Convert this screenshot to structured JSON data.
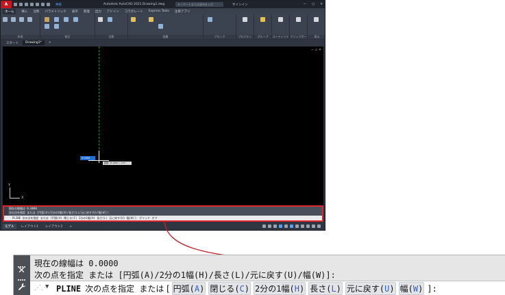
{
  "app": {
    "logo": "A",
    "share_label": "共有",
    "title": "Autodesk AutoCAD 2021   Drawing1.dwg",
    "search_placeholder": "キーワードまたは語句を入力",
    "signin": "サインイン",
    "window_controls": [
      "—",
      "□",
      "✕"
    ]
  },
  "ribbon_tabs": [
    {
      "label": "ホーム",
      "active": true
    },
    {
      "label": "挿入"
    },
    {
      "label": "注釈"
    },
    {
      "label": "パラメトリック"
    },
    {
      "label": "表示"
    },
    {
      "label": "管理"
    },
    {
      "label": "出力"
    },
    {
      "label": "アドイン"
    },
    {
      "label": "コラボレート"
    },
    {
      "label": "Express Tools"
    },
    {
      "label": "注目アプリ"
    }
  ],
  "ribbon_groups": [
    {
      "label": "作成"
    },
    {
      "label": "修正"
    },
    {
      "label": "注釈"
    },
    {
      "label": "画層"
    },
    {
      "label": "ブロック"
    },
    {
      "label": "プロパティ"
    },
    {
      "label": "グループ"
    },
    {
      "label": "ユーティリティ"
    },
    {
      "label": "クリップボード"
    },
    {
      "label": "表示"
    }
  ],
  "doc_tabs": [
    {
      "label": "スタート"
    },
    {
      "label": "Drawing1*",
      "active": true
    }
  ],
  "canvas": {
    "dyn_input_value": "0.0000",
    "dyn_tip": "距離: 45.0846 < 167°",
    "ucs_y": "Y",
    "ucs_x": "X"
  },
  "mini_cmd": {
    "line1": "現在の線幅は 0.0000",
    "line2": "次の点を指定 または [円弧(A)/2分の1幅(H)/長さ(L)/元に戻す(U)/幅(W)]:",
    "input": "PLINE 次の点を指定 または [円弧(A) 閉じる(C) 2分の1幅(H) 長さ(L) 元に戻す(U) 幅(W)]:   グリッド オフ"
  },
  "layout_tabs": [
    {
      "label": "モデル",
      "active": true
    },
    {
      "label": "レイアウト1"
    },
    {
      "label": "レイアウト2"
    },
    {
      "label": "+"
    }
  ],
  "command_zoom": {
    "history_line1_prefix": "現在の線幅は",
    "history_line1_value": "0.0000",
    "history_line2": "次の点を指定 または [円弧(A)/2分の1幅(H)/長さ(L)/元に戻す(U)/幅(W)]:",
    "command": "PLINE",
    "prompt": "次の点を指定 または",
    "options": [
      {
        "label": "円弧",
        "key": "A"
      },
      {
        "label": "閉じる",
        "key": "C"
      },
      {
        "label": "2分の1幅",
        "key": "H"
      },
      {
        "label": "長さ",
        "key": "L"
      },
      {
        "label": "元に戻す",
        "key": "U"
      },
      {
        "label": "幅",
        "key": "W"
      }
    ],
    "close_icon": "✕",
    "wrench_icon": "🔧"
  },
  "colors": {
    "callout": "#c0262c",
    "highlight_border": "#e0272a",
    "option_key": "#2b5fce"
  }
}
